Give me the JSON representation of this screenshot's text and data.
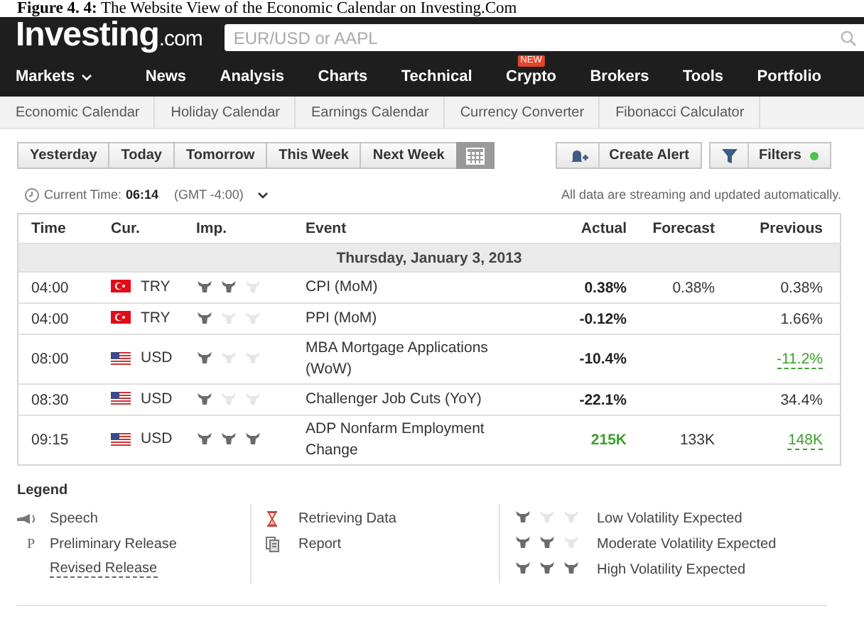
{
  "caption": {
    "label": "Figure 4. 4:",
    "text": "The Website View of the Economic Calendar on Investing.Com"
  },
  "header": {
    "logo": "Investing",
    "logo_suffix": ".com",
    "search": {
      "placeholder": "EUR/USD or AAPL"
    },
    "nav": [
      {
        "label": "Markets",
        "dropdown": true
      },
      {
        "label": "News",
        "dropdown": false
      },
      {
        "label": "Analysis",
        "dropdown": false
      },
      {
        "label": "Charts",
        "dropdown": false
      },
      {
        "label": "Technical",
        "dropdown": false
      },
      {
        "label": "Crypto",
        "dropdown": false,
        "badge": "NEW"
      },
      {
        "label": "Brokers",
        "dropdown": false
      },
      {
        "label": "Tools",
        "dropdown": false
      },
      {
        "label": "Portfolio",
        "dropdown": false
      }
    ]
  },
  "subnav": [
    "Economic Calendar",
    "Holiday Calendar",
    "Earnings Calendar",
    "Currency Converter",
    "Fibonacci Calculator"
  ],
  "range_buttons": [
    "Yesterday",
    "Today",
    "Tomorrow",
    "This Week",
    "Next Week"
  ],
  "actions": [
    {
      "kind": "alert",
      "label": "Create Alert"
    },
    {
      "kind": "filters",
      "label": "Filters",
      "active": true
    }
  ],
  "time_bar": {
    "label": "Current Time:",
    "time": "06:14",
    "zone": "(GMT -4:00)",
    "note": "All data are streaming and updated automatically."
  },
  "table": {
    "columns": [
      "Time",
      "Cur.",
      "Imp.",
      "Event",
      "Actual",
      "Forecast",
      "Previous"
    ],
    "date": "Thursday, January 3, 2013",
    "rows": [
      {
        "time": "04:00",
        "kind": "tr",
        "currency": "TRY",
        "stars": 2,
        "event": "CPI (MoM)",
        "actual": "0.38%",
        "actual_better": false,
        "forecast": "0.38%",
        "previous": "0.38%",
        "previous_revised": false
      },
      {
        "time": "04:00",
        "kind": "tr",
        "currency": "TRY",
        "stars": 1,
        "event": "PPI (MoM)",
        "actual": "-0.12%",
        "actual_better": false,
        "previous": "1.66%",
        "previous_revised": false
      },
      {
        "time": "08:00",
        "kind": "us",
        "currency": "USD",
        "stars": 1,
        "event": "MBA Mortgage Applications (WoW)",
        "actual": "-10.4%",
        "actual_better": false,
        "previous": "-11.2%",
        "previous_revised": true
      },
      {
        "time": "08:30",
        "kind": "us",
        "currency": "USD",
        "stars": 1,
        "event": "Challenger Job Cuts (YoY)",
        "actual": "-22.1%",
        "actual_better": false,
        "previous": "34.4%",
        "previous_revised": false
      },
      {
        "time": "09:15",
        "kind": "us",
        "currency": "USD",
        "stars": 3,
        "event": "ADP Nonfarm Employment Change",
        "actual": "215K",
        "actual_better": true,
        "forecast": "133K",
        "previous": "148K",
        "previous_revised": true
      }
    ]
  },
  "legend": {
    "title": "Legend",
    "columns": [
      [
        {
          "kind": "speech",
          "label": "Speech"
        },
        {
          "kind": "preliminary",
          "glyph": "P",
          "label": "Preliminary Release"
        },
        {
          "kind": "revised",
          "label": "Revised Release"
        }
      ],
      [
        {
          "kind": "retrieving",
          "label": "Retrieving Data"
        },
        {
          "kind": "report",
          "label": "Report"
        }
      ],
      [
        {
          "kind": "volatility",
          "stars": 1,
          "label": "Low Volatility Expected"
        },
        {
          "kind": "volatility",
          "stars": 2,
          "label": "Moderate Volatility Expected"
        },
        {
          "kind": "volatility",
          "stars": 3,
          "label": "High Volatility Expected"
        }
      ]
    ]
  }
}
